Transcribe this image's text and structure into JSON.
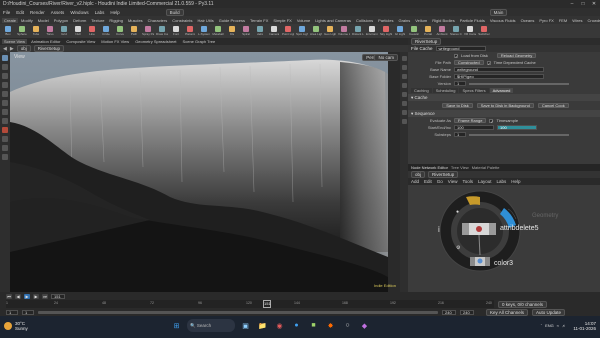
{
  "window": {
    "title": "D:/Houdini_Courses/River/River_v2.hiplc - Houdini Indie Limited-Commercial 21.0.559 - Py3.11"
  },
  "menu": {
    "items": [
      "File",
      "Edit",
      "Render",
      "Assets",
      "Windows",
      "Labs",
      "Help"
    ],
    "build": "Build",
    "main": "Main"
  },
  "shelf_tabs": [
    "Create",
    "Modify",
    "Model",
    "Polygon",
    "Deform",
    "Texture",
    "Rigging",
    "Muscles",
    "Characters",
    "Constraints",
    "Hair Utils",
    "Guide Process",
    "Terrain FX",
    "Simple FX",
    "Volume",
    "Lights and Cameras",
    "Collisions",
    "Particles",
    "Grains",
    "Vellum",
    "Rigid Bodies",
    "Particle Fluids",
    "Viscous Fluids",
    "Oceans",
    "Pyro FX",
    "FEM",
    "Wires",
    "Crowds",
    "Drive Simulation"
  ],
  "shelf_tools": [
    "Box",
    "Sphere",
    "Tube",
    "Torus",
    "Grid",
    "Null",
    "Line",
    "Circle",
    "Curve",
    "Path",
    "Spray Paint",
    "Draw Curve",
    "Font",
    "Platonic",
    "L-System",
    "Metaball",
    "File",
    "Spiral",
    "Helix",
    "Camera",
    "Point Light",
    "Spot Light",
    "Area Light",
    "Geo Light",
    "Volume Light",
    "Distant Light",
    "Environment",
    "Sky Light",
    "GI Light",
    "Caustic",
    "Portal",
    "Ambient",
    "Stereo Cam",
    "VR Camera",
    "Switcher"
  ],
  "pane_tabs": [
    "Scene View",
    "Animation Editor",
    "Composite View",
    "Motion FX View",
    "Geometry Spreadsheet",
    "Scene Graph Tree"
  ],
  "path": {
    "root": "obj",
    "node": "RiverSetup"
  },
  "viewport": {
    "label": "View",
    "persp": "Persp",
    "cam": "No cam",
    "tag": "Indie Edition"
  },
  "params": {
    "node_type": "File Cache",
    "node_name": "writeground",
    "tabs": [
      "Caching",
      "Scheduling",
      "Specs Filters",
      "Advanced"
    ],
    "active_tab": "Advanced",
    "load_from_disk": "Load from Disk",
    "reload_geometry": "Reload Geometry",
    "file_path_label": "File Path",
    "file_path_mode": "Constructed",
    "time_dependent": "Time Dependent Cache",
    "base_name_label": "Base Name",
    "base_name": "writeground",
    "base_folder_label": "Base Folder",
    "base_folder": "$HIP/geo",
    "version_label": "Version",
    "version": "1",
    "cache_section": "Cache",
    "save_disk": "Save to Disk",
    "save_bg": "Save to Disk in Background",
    "cancel": "Cancel Cook",
    "sequence_section": "Sequence",
    "evaluate_label": "Evaluate As",
    "evaluate_value": "Frame Range",
    "timesample": "Timesample",
    "start_end_label": "Start/End/Inc",
    "start": "100",
    "end": "100",
    "substeps_label": "Substeps",
    "substeps": "1"
  },
  "network": {
    "tabs": [
      "Node Network Editor",
      "Tree View",
      "Material Palette"
    ],
    "path_root": "obj",
    "path_node": "RiverSetup",
    "menu": [
      "Add",
      "Edit",
      "Go",
      "View",
      "Tools",
      "Layout",
      "Labs",
      "Help"
    ],
    "node1": "attribdelete5",
    "node2": "color3",
    "ghost": "Geometry"
  },
  "timeline": {
    "frame": "151",
    "start_frame": "1",
    "end_frame": "240",
    "ticks": [
      "1",
      "24",
      "48",
      "72",
      "96",
      "120",
      "144",
      "168",
      "192",
      "216",
      "240"
    ],
    "key_channels": "0 keys, 0/0 channels",
    "key_all": "Key All Channels",
    "auto_update": "Auto Update"
  },
  "taskbar": {
    "weather_temp": "30°C",
    "weather_desc": "Sunny",
    "search_placeholder": "Search",
    "lang": "ENG",
    "region": "US",
    "time": "14:07",
    "date": "11-01-2026"
  },
  "colors": {
    "accent": "#2f8fd6",
    "houdini_orange": "#ff6a00",
    "node_blue": "#2f8fd6"
  }
}
